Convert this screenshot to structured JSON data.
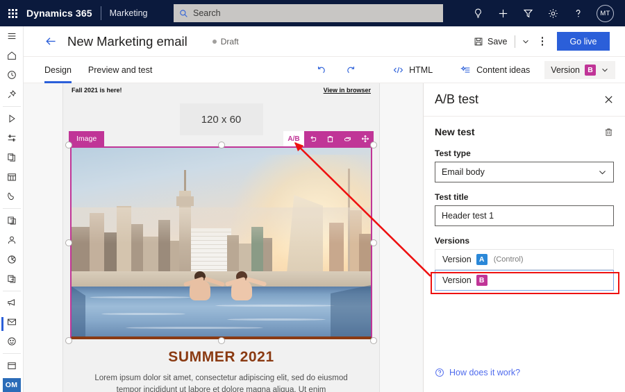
{
  "topbar": {
    "waffle": "app-launcher",
    "brand": "Dynamics 365",
    "app_name": "Marketing",
    "search_placeholder": "Search",
    "icons": [
      "lightbulb-icon",
      "plus-icon",
      "filter-icon",
      "gear-icon",
      "help-icon"
    ],
    "avatar_initials": "MT",
    "background": "#0b1a3d"
  },
  "rail": {
    "items": [
      {
        "name": "hamburger-menu",
        "label": "Menu"
      },
      {
        "name": "home",
        "label": "Home"
      },
      {
        "name": "recent",
        "label": "Recent"
      },
      {
        "name": "pinned",
        "label": "Pinned"
      },
      {
        "name": "play",
        "label": "Customer journeys"
      },
      {
        "name": "segments",
        "label": "Segments"
      },
      {
        "name": "pages",
        "label": "Marketing pages"
      },
      {
        "name": "calendar",
        "label": "Events"
      },
      {
        "name": "phone",
        "label": "Phone calls"
      },
      {
        "name": "forms",
        "label": "Marketing forms"
      },
      {
        "name": "contacts",
        "label": "Contacts"
      },
      {
        "name": "insights",
        "label": "Insights"
      },
      {
        "name": "documents",
        "label": "Documents"
      },
      {
        "name": "campaign",
        "label": "Campaigns"
      },
      {
        "name": "email",
        "label": "Marketing emails",
        "active": true
      },
      {
        "name": "smiley",
        "label": "Customer voice"
      },
      {
        "name": "date",
        "label": "Calendar"
      }
    ],
    "org_tile": "OM"
  },
  "command_bar": {
    "back": "back-arrow",
    "title": "New Marketing email",
    "status": "Draft",
    "save_label": "Save",
    "more_label": "More commands",
    "go_live_label": "Go live",
    "go_live_color": "#2b5fd9"
  },
  "tabs": {
    "items": [
      {
        "label": "Design",
        "active": true
      },
      {
        "label": "Preview and test",
        "active": false
      }
    ],
    "undo_label": "Undo",
    "redo_label": "Redo",
    "html_label": "HTML",
    "content_ideas_label": "Content ideas",
    "version_chip": {
      "label": "Version",
      "badge": "B",
      "badge_color": "#c03597"
    }
  },
  "email": {
    "preheader_left": "Fall 2021 is here!",
    "preheader_right": "View in browser",
    "logo_placeholder": "120 x 60",
    "selection_label": "Image",
    "selection_toolbar": [
      {
        "name": "ab-test-button",
        "label": "A/B"
      },
      {
        "name": "undo-icon",
        "label": "Undo"
      },
      {
        "name": "delete-icon",
        "label": "Delete"
      },
      {
        "name": "duplicate-icon",
        "label": "Duplicate"
      },
      {
        "name": "move-icon",
        "label": "Move"
      }
    ],
    "hero_alt": "Couple in rooftop infinity pool overlooking New York City skyline at sunset",
    "heading": "SUMMER 2021",
    "body": "Lorem ipsum dolor sit amet, consectetur adipiscing elit, sed do eiusmod tempor incididunt ut labore et dolore magna aliqua. Ut enim",
    "heading_color": "#8a3a12",
    "accent_color": "#c03597"
  },
  "panel": {
    "title": "A/B test",
    "close_label": "Close",
    "test_name": "New test",
    "delete_label": "Delete test",
    "test_type_label": "Test type",
    "test_type_value": "Email body",
    "test_title_label": "Test title",
    "test_title_value": "Header test 1",
    "versions_label": "Versions",
    "versions": [
      {
        "label": "Version",
        "badge": "A",
        "badge_color": "#2b88d8",
        "note": "(Control)",
        "selected": false
      },
      {
        "label": "Version",
        "badge": "B",
        "badge_color": "#c03597",
        "note": "",
        "selected": true
      }
    ],
    "help_link": "How does it work?",
    "help_link_color": "#4f6bed",
    "highlight_color": "#ee1111"
  }
}
